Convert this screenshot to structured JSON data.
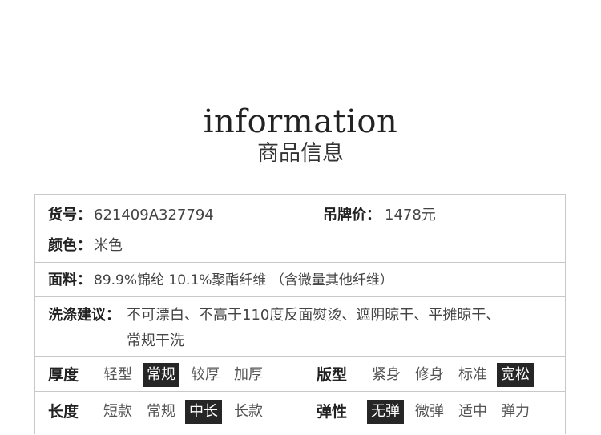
{
  "header": {
    "title_en": "information",
    "title_cn": "商品信息"
  },
  "info": {
    "sku_label": "货号：",
    "sku_value": "621409A327794",
    "price_label": "吊牌价：",
    "price_value": "1478元",
    "color_label": "颜色：",
    "color_value": "米色",
    "fabric_label": "面料：",
    "fabric_value": "89.9%锦纶 10.1%聚酯纤维 （含微量其他纤维）",
    "wash_label": "洗涤建议：",
    "wash_line1": "不可漂白、不高于110度反面熨烫、遮阴晾干、平摊晾干、",
    "wash_line2": "常规干洗"
  },
  "attributes": {
    "thickness": {
      "label": "厚度",
      "options": [
        "轻型",
        "常规",
        "较厚",
        "加厚"
      ],
      "selected": "常规"
    },
    "fit": {
      "label": "版型",
      "options": [
        "紧身",
        "修身",
        "标准",
        "宽松"
      ],
      "selected": "宽松"
    },
    "length": {
      "label": "长度",
      "options": [
        "短款",
        "常规",
        "中长",
        "长款"
      ],
      "selected": "中长"
    },
    "elasticity": {
      "label": "弹性",
      "options": [
        "无弹",
        "微弹",
        "适中",
        "弹力"
      ],
      "selected": "无弹"
    }
  },
  "colors": {
    "selected_bg": "#262626",
    "selected_text": "#ffffff",
    "border": "#c8c8c8"
  }
}
